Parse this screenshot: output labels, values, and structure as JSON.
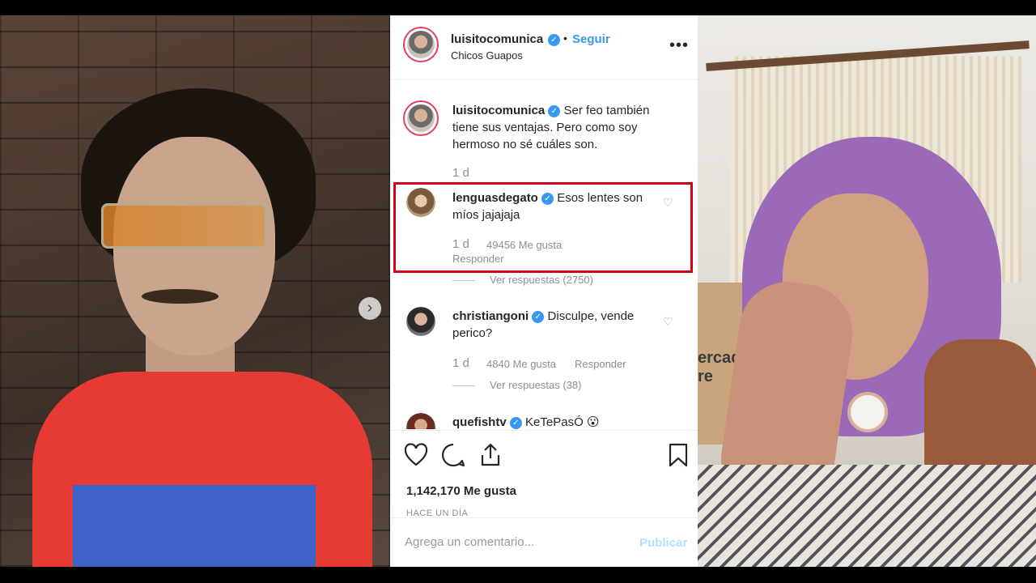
{
  "post": {
    "username": "luisitocomunica",
    "follow_label": "Seguir",
    "dot": "•",
    "location": "Chicos Guapos",
    "caption": "Ser feo también tiene sus ventajas. Pero como soy hermoso no sé cuáles son.",
    "caption_time": "1 d",
    "likes": "1,142,170 Me gusta",
    "posted_ago": "HACE UN DÍA"
  },
  "comments": [
    {
      "username": "lenguasdegato",
      "text": "Esos lentes son míos jajajaja",
      "time": "1 d",
      "likes": "49456 Me gusta",
      "reply_label": "Responder",
      "view_replies": "Ver respuestas (2750)"
    },
    {
      "username": "christiangoni",
      "text": "Disculpe, vende perico?",
      "time": "1 d",
      "likes": "4840 Me gusta",
      "reply_label": "Responder",
      "view_replies": "Ver respuestas (38)"
    },
    {
      "username": "quefishtv",
      "text": "KeTePasÓ 😮"
    }
  ],
  "add_comment": {
    "placeholder": "Agrega un comentario...",
    "publish_label": "Publicar"
  },
  "right_photo": {
    "box_text": "ercado\nre"
  },
  "icons": {
    "more": "more-options-icon",
    "heart": "heart-icon",
    "comment": "comment-icon",
    "share": "share-icon",
    "bookmark": "bookmark-icon",
    "next": "chevron-right-icon"
  },
  "colors": {
    "link_blue": "#3897f0",
    "highlight_red": "#d0021b",
    "publish_disabled": "#b2dffc"
  }
}
